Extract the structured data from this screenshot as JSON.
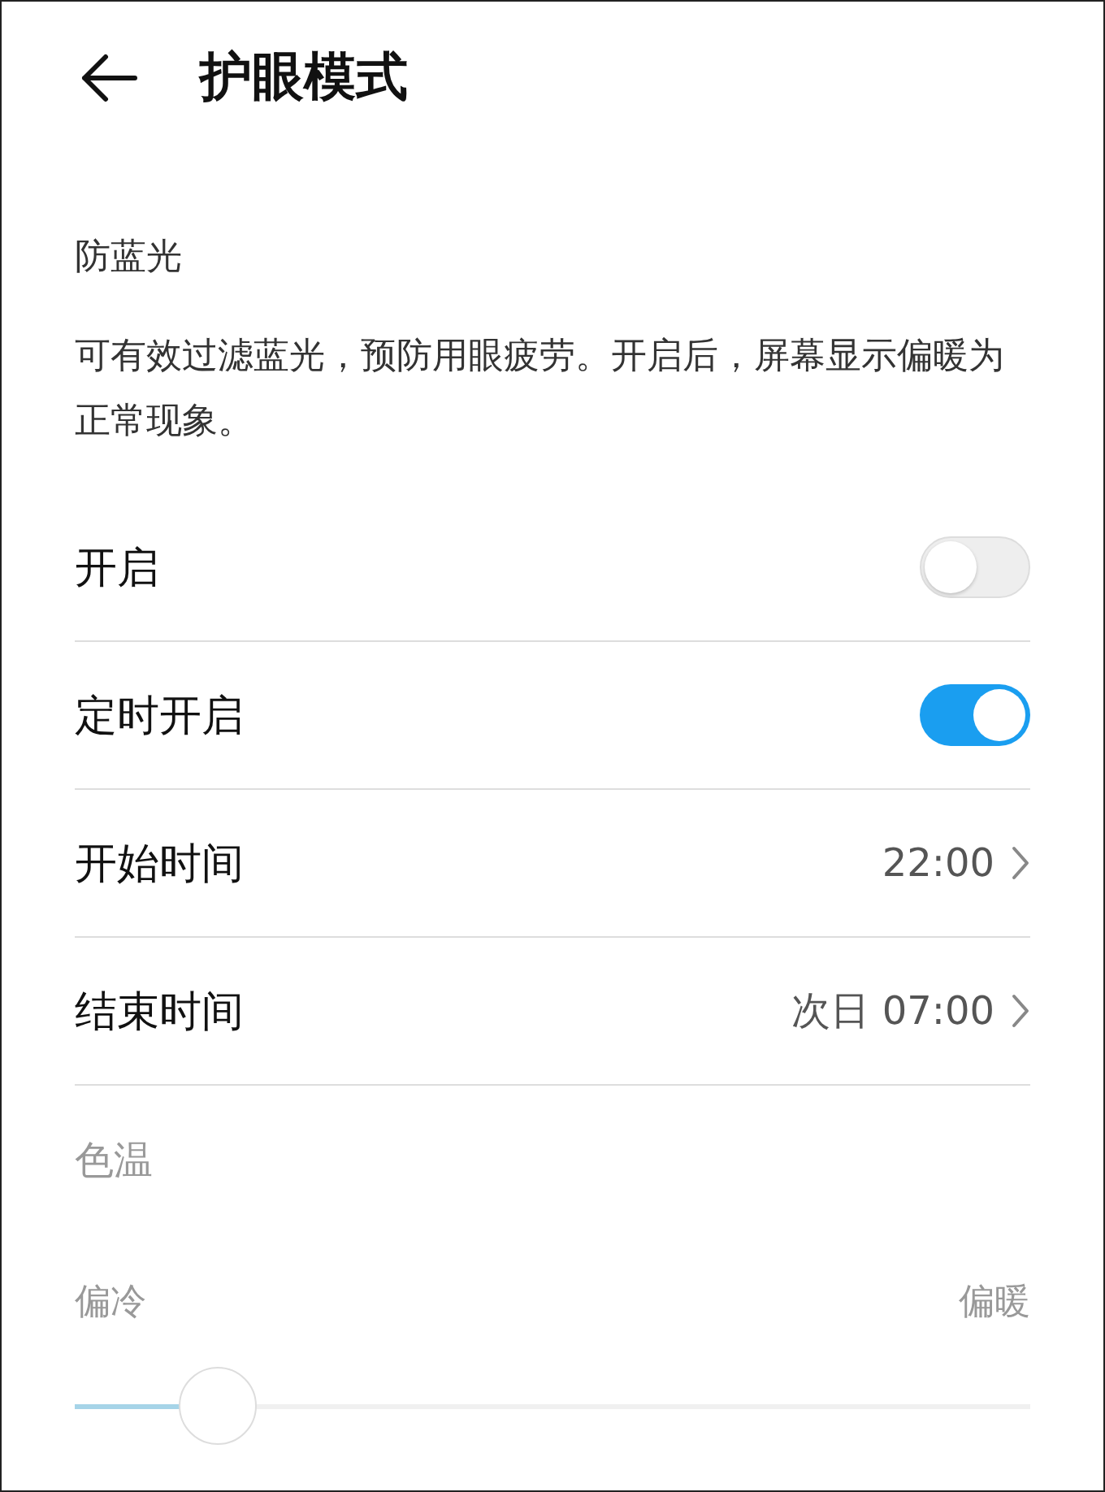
{
  "header": {
    "title": "护眼模式"
  },
  "section": {
    "label": "防蓝光",
    "description": "可有效过滤蓝光，预防用眼疲劳。开启后，屏幕显示偏暖为正常现象。"
  },
  "rows": [
    {
      "kind": "switch",
      "label": "开启",
      "on": false
    },
    {
      "kind": "switch",
      "label": "定时开启",
      "on": true
    },
    {
      "kind": "value",
      "label": "开始时间",
      "value": "22:00"
    },
    {
      "kind": "value",
      "label": "结束时间",
      "value": "次日 07:00"
    }
  ],
  "color_temperature": {
    "label": "色温",
    "disabled": true,
    "min_label": "偏冷",
    "max_label": "偏暖",
    "level": 0.15
  }
}
